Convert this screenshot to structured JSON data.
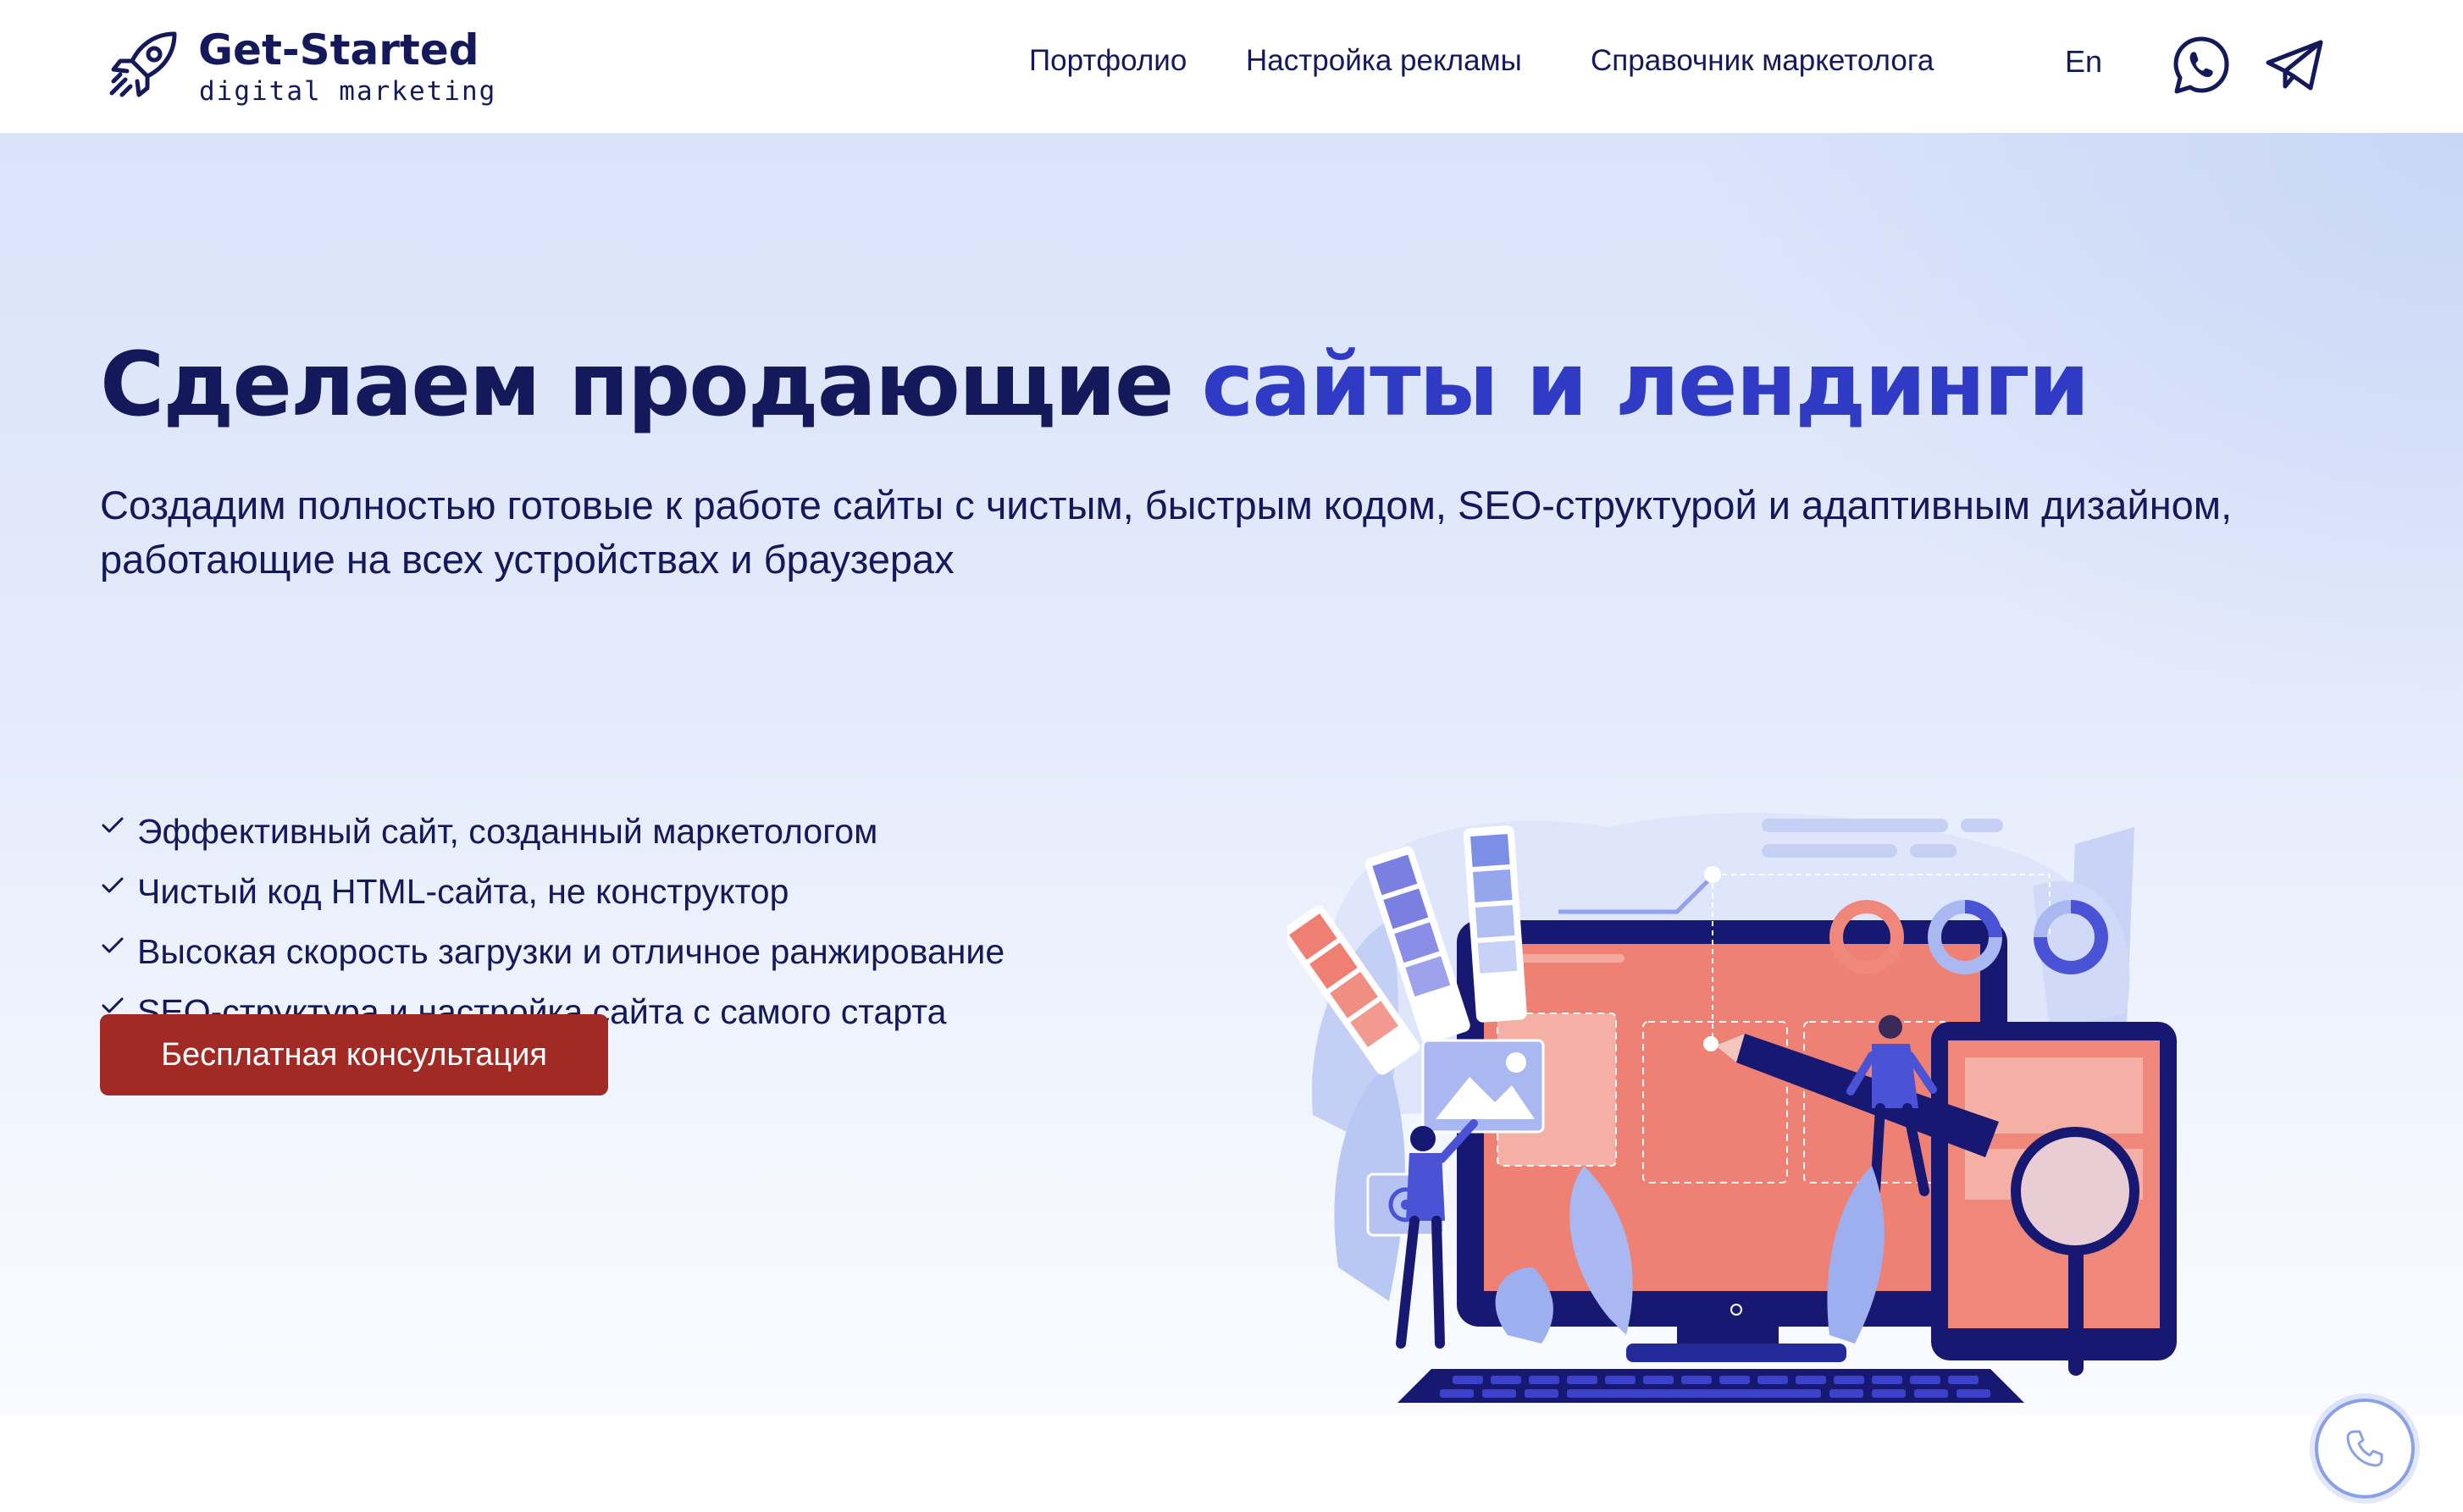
{
  "brand": {
    "name": "Get-Started",
    "tagline": "digital marketing",
    "icon": "rocket-icon"
  },
  "nav": {
    "items": [
      {
        "label": "Портфолио"
      },
      {
        "label": "Настройка рекламы"
      },
      {
        "label": "Справочник маркетолога"
      }
    ],
    "lang": "En",
    "social": [
      "whatsapp-icon",
      "telegram-icon"
    ]
  },
  "hero": {
    "title_main": "Сделаем продающие ",
    "title_accent": "сайты и лендинги",
    "subtitle": "Создадим полностью готовые к работе сайты с чистым, быстрым кодом, SEO-структурой и адаптивным дизайном, работающие на всех устройствах и браузерах",
    "features": [
      "Эффективный сайт, созданный маркетологом",
      "Чистый код HTML-сайта, не конструктор",
      "Высокая скорость загрузки и отличное ранжирование",
      "SEO-структура и настройка сайта с самого старта"
    ],
    "cta_label": "Бесплатная консультация"
  },
  "floating": {
    "call_icon": "phone-icon"
  },
  "colors": {
    "primary": "#13195a",
    "accent": "#2f3bc4",
    "cta": "#a22a25",
    "illustration_coral": "#ee8074"
  }
}
